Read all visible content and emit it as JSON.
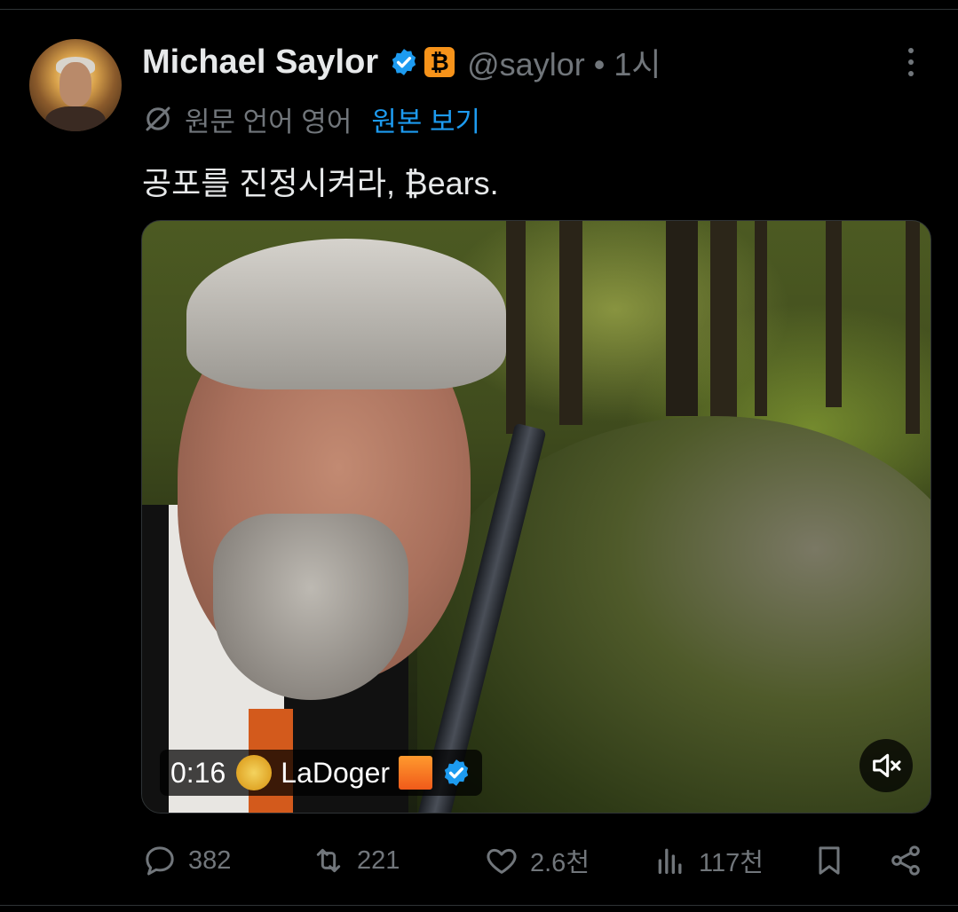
{
  "post": {
    "author_name": "Michael Saylor",
    "btc_badge": "₿",
    "handle": "@saylor",
    "separator": "•",
    "time": "1시",
    "translation_note": "원문 언어 영어",
    "show_original": "원본 보기",
    "text": "공포를 진정시켜라, ₿ears."
  },
  "video": {
    "timestamp": "0:16",
    "uploader": "LaDoger",
    "muted": true
  },
  "actions": {
    "replies": "382",
    "reposts": "221",
    "likes": "2.6천",
    "views": "117천"
  },
  "colors": {
    "accent": "#1d9bf0",
    "btc_orange": "#f7931a",
    "muted_text": "#71767b",
    "background": "#000000"
  },
  "icons": [
    "verified-badge-icon",
    "bitcoin-icon",
    "more-icon",
    "translate-icon",
    "mute-icon",
    "reply-icon",
    "repost-icon",
    "like-icon",
    "views-icon",
    "bookmark-icon",
    "share-icon"
  ]
}
